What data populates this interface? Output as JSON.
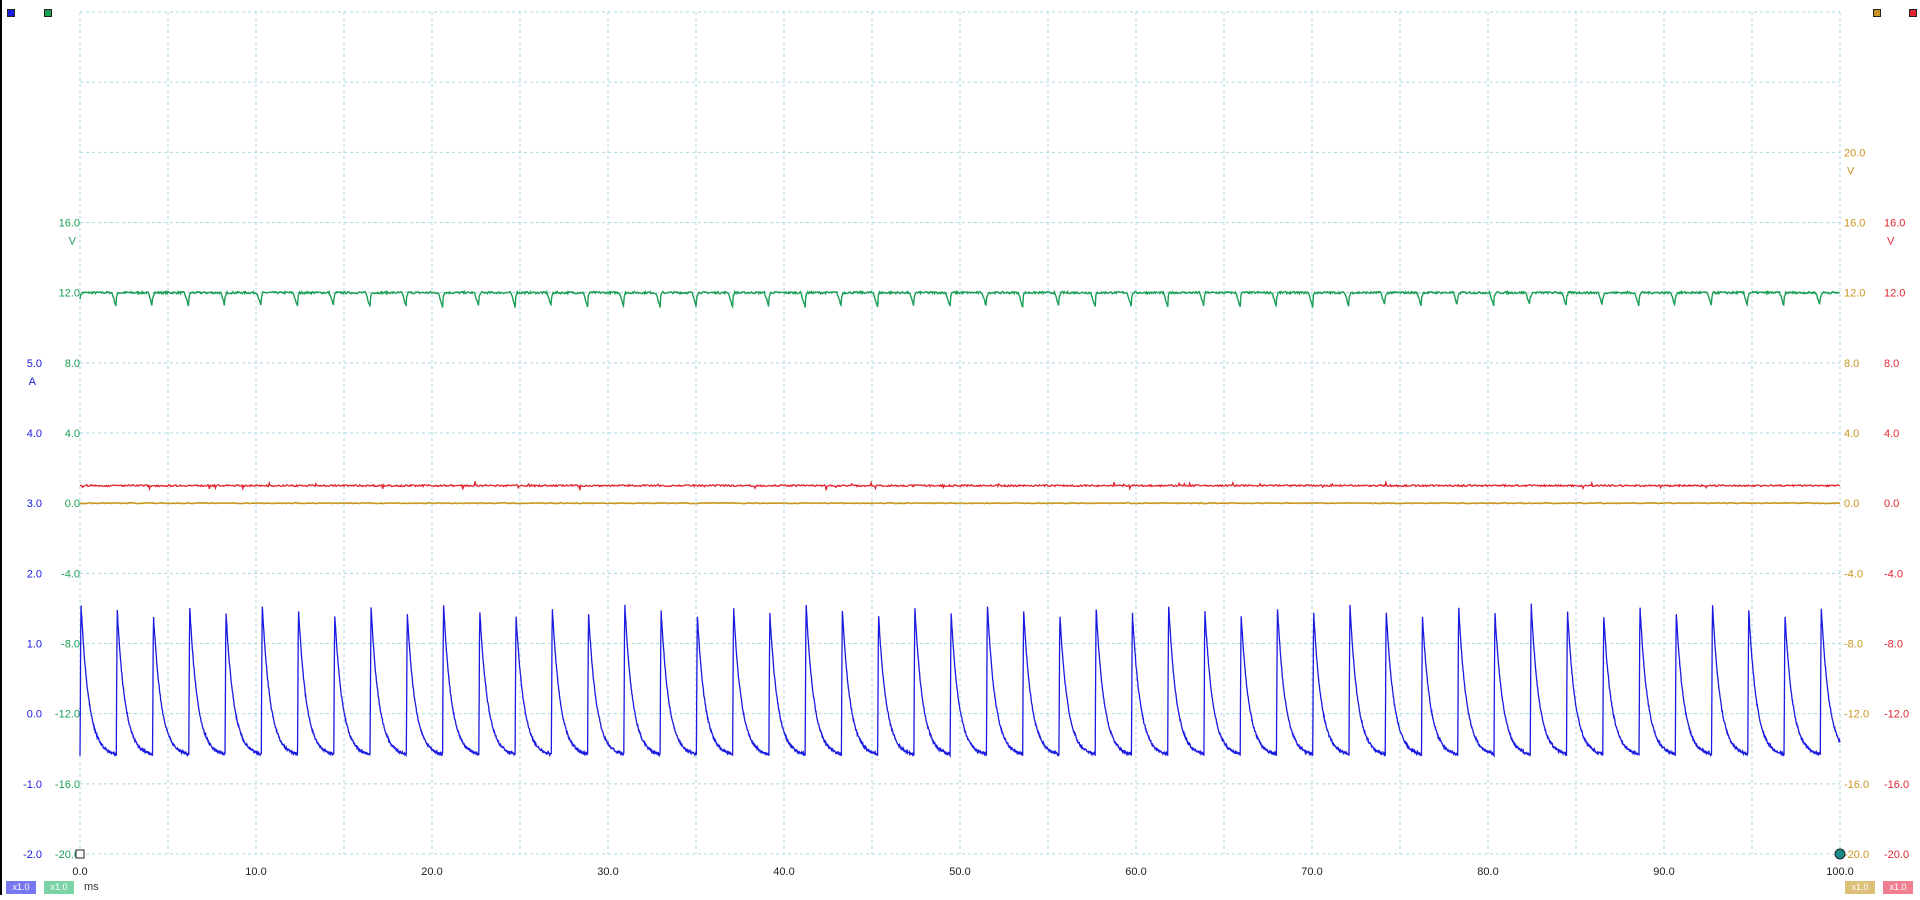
{
  "channels": [
    {
      "id": "A",
      "color": "#1a1ae0",
      "unit": "A",
      "side": "left",
      "col": 0,
      "ticks": [
        "5.0",
        "4.0",
        "3.0",
        "2.0",
        "1.0",
        "0.0",
        "-1.0",
        "-2.0"
      ],
      "range": [
        -2,
        5
      ],
      "scale": "x1.0",
      "badge": "#7878f0"
    },
    {
      "id": "B",
      "color": "#1a9e55",
      "unit": "V",
      "side": "left",
      "col": 1,
      "ticks": [
        "16.0",
        "12.0",
        "8.0",
        "4.0",
        "0.0",
        "-4.0",
        "-8.0",
        "-12.0",
        "-16.0",
        "-20.0"
      ],
      "range": [
        -20,
        16
      ],
      "scale": "x1.0",
      "badge": "#79d3a5"
    },
    {
      "id": "C",
      "color": "#c8961e",
      "unit": "V",
      "side": "right",
      "col": 0,
      "ticks": [
        "20.0",
        "16.0",
        "12.0",
        "8.0",
        "4.0",
        "0.0",
        "-4.0",
        "-8.0",
        "-12.0",
        "-16.0",
        "-20.0"
      ],
      "range": [
        -20,
        20
      ],
      "scale": "x1.0",
      "badge": "#dcc07a"
    },
    {
      "id": "D",
      "color": "#e02530",
      "unit": "V",
      "side": "right",
      "col": 1,
      "ticks": [
        "16.0",
        "12.0",
        "8.0",
        "4.0",
        "0.0",
        "-4.0",
        "-8.0",
        "-12.0",
        "-16.0",
        "-20.0"
      ],
      "range": [
        -20,
        16
      ],
      "scale": "x1.0",
      "badge": "#f08090"
    }
  ],
  "x_axis": {
    "unit": "ms",
    "ticks": [
      "0.0",
      "10.0",
      "20.0",
      "30.0",
      "40.0",
      "50.0",
      "60.0",
      "70.0",
      "80.0",
      "90.0",
      "100.0"
    ]
  },
  "chart_data": {
    "type": "line",
    "x": {
      "unit": "ms",
      "range": [
        0,
        100
      ],
      "major_step": 10,
      "minor_step": 5
    },
    "grid": true,
    "series": [
      {
        "channel": "B",
        "unit": "V",
        "description": "steady ~12 V with periodic dips to ~11.2 V",
        "baseline": 12.0,
        "dip_min": 11.2,
        "period_ms": 2.06
      },
      {
        "channel": "D",
        "unit": "V",
        "description": "flat ~1.0 V with small noise spikes",
        "level": 1.0
      },
      {
        "channel": "C",
        "unit": "V",
        "description": "flat ~0.0 V",
        "level": 0.0
      },
      {
        "channel": "A",
        "unit": "A",
        "description": "periodic current spikes to ~1.6 A decaying to ~-0.6 A",
        "peak": 1.6,
        "trough": -0.6,
        "period_ms": 2.06
      }
    ]
  }
}
